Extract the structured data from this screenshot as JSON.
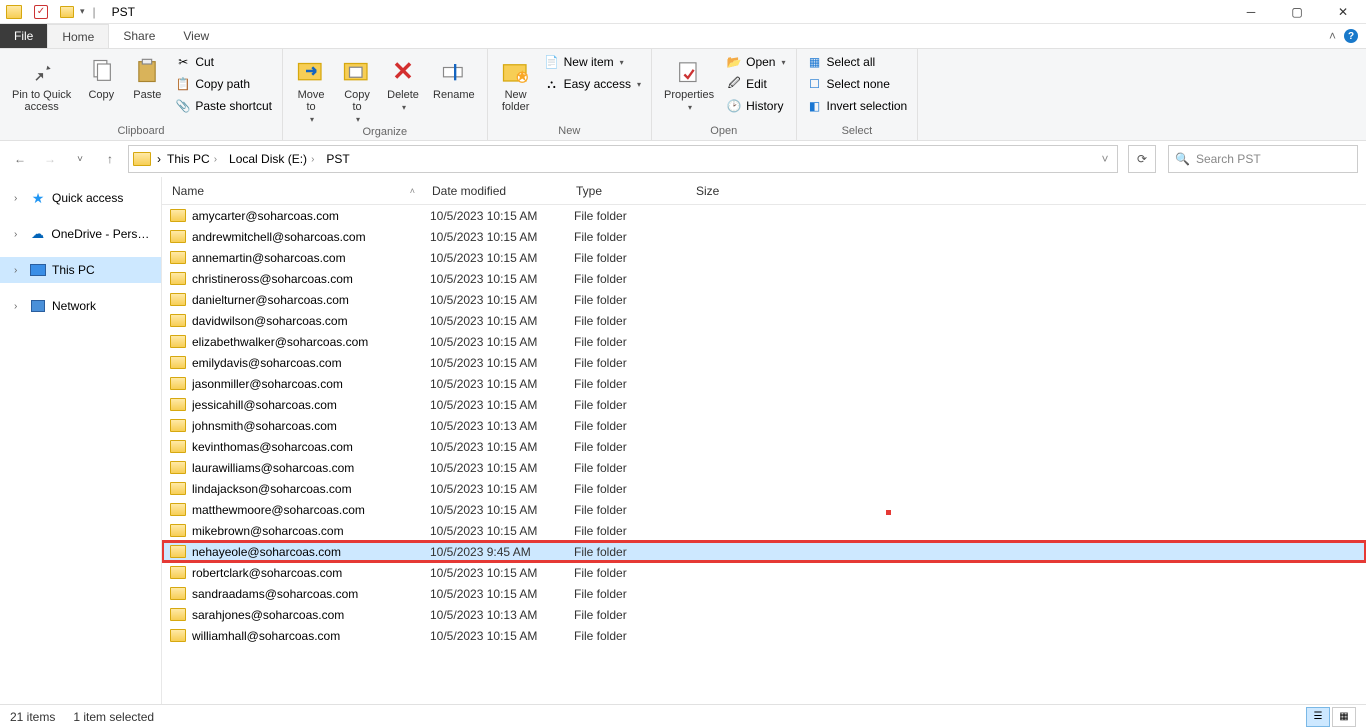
{
  "window": {
    "title": "PST"
  },
  "tabs": {
    "file": "File",
    "home": "Home",
    "share": "Share",
    "view": "View"
  },
  "ribbon": {
    "clipboard": {
      "pin": "Pin to Quick\naccess",
      "copy": "Copy",
      "paste": "Paste",
      "cut": "Cut",
      "copy_path": "Copy path",
      "paste_shortcut": "Paste shortcut",
      "group": "Clipboard"
    },
    "organize": {
      "move_to": "Move\nto",
      "copy_to": "Copy\nto",
      "delete": "Delete",
      "rename": "Rename",
      "group": "Organize"
    },
    "new": {
      "new_folder": "New\nfolder",
      "new_item": "New item",
      "easy_access": "Easy access",
      "group": "New"
    },
    "open": {
      "properties": "Properties",
      "open": "Open",
      "edit": "Edit",
      "history": "History",
      "group": "Open"
    },
    "select": {
      "select_all": "Select all",
      "select_none": "Select none",
      "invert": "Invert selection",
      "group": "Select"
    }
  },
  "breadcrumb": [
    "This PC",
    "Local Disk (E:)",
    "PST"
  ],
  "search_placeholder": "Search PST",
  "nav": {
    "quick_access": "Quick access",
    "onedrive": "OneDrive - Persona",
    "this_pc": "This PC",
    "network": "Network"
  },
  "columns": {
    "name": "Name",
    "date": "Date modified",
    "type": "Type",
    "size": "Size"
  },
  "items": [
    {
      "name": "amycarter@soharcoas.com",
      "date": "10/5/2023 10:15 AM",
      "type": "File folder"
    },
    {
      "name": "andrewmitchell@soharcoas.com",
      "date": "10/5/2023 10:15 AM",
      "type": "File folder"
    },
    {
      "name": "annemartin@soharcoas.com",
      "date": "10/5/2023 10:15 AM",
      "type": "File folder"
    },
    {
      "name": "christineross@soharcoas.com",
      "date": "10/5/2023 10:15 AM",
      "type": "File folder"
    },
    {
      "name": "danielturner@soharcoas.com",
      "date": "10/5/2023 10:15 AM",
      "type": "File folder"
    },
    {
      "name": "davidwilson@soharcoas.com",
      "date": "10/5/2023 10:15 AM",
      "type": "File folder"
    },
    {
      "name": "elizabethwalker@soharcoas.com",
      "date": "10/5/2023 10:15 AM",
      "type": "File folder"
    },
    {
      "name": "emilydavis@soharcoas.com",
      "date": "10/5/2023 10:15 AM",
      "type": "File folder"
    },
    {
      "name": "jasonmiller@soharcoas.com",
      "date": "10/5/2023 10:15 AM",
      "type": "File folder"
    },
    {
      "name": "jessicahill@soharcoas.com",
      "date": "10/5/2023 10:15 AM",
      "type": "File folder"
    },
    {
      "name": "johnsmith@soharcoas.com",
      "date": "10/5/2023 10:13 AM",
      "type": "File folder"
    },
    {
      "name": "kevinthomas@soharcoas.com",
      "date": "10/5/2023 10:15 AM",
      "type": "File folder"
    },
    {
      "name": "laurawilliams@soharcoas.com",
      "date": "10/5/2023 10:15 AM",
      "type": "File folder"
    },
    {
      "name": "lindajackson@soharcoas.com",
      "date": "10/5/2023 10:15 AM",
      "type": "File folder"
    },
    {
      "name": "matthewmoore@soharcoas.com",
      "date": "10/5/2023 10:15 AM",
      "type": "File folder"
    },
    {
      "name": "mikebrown@soharcoas.com",
      "date": "10/5/2023 10:15 AM",
      "type": "File folder"
    },
    {
      "name": "nehayeole@soharcoas.com",
      "date": "10/5/2023 9:45 AM",
      "type": "File folder",
      "selected": true,
      "highlighted": true
    },
    {
      "name": "robertclark@soharcoas.com",
      "date": "10/5/2023 10:15 AM",
      "type": "File folder"
    },
    {
      "name": "sandraadams@soharcoas.com",
      "date": "10/5/2023 10:15 AM",
      "type": "File folder"
    },
    {
      "name": "sarahjones@soharcoas.com",
      "date": "10/5/2023 10:13 AM",
      "type": "File folder"
    },
    {
      "name": "williamhall@soharcoas.com",
      "date": "10/5/2023 10:15 AM",
      "type": "File folder"
    }
  ],
  "status": {
    "count": "21 items",
    "selected": "1 item selected"
  }
}
